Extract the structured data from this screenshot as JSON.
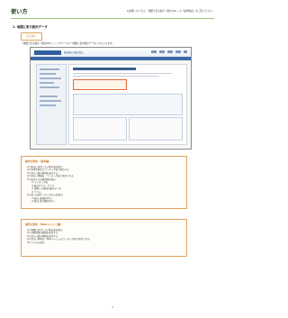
{
  "header": {
    "title": "使い方",
    "note": "※詳細については、「地図で見る統計（統計GIS）」の「操作解説」をご覧ください。"
  },
  "section": {
    "heading": "1. 地図に表す統計データ",
    "tag": "はじめに",
    "intro": "「地図で見る統計（統計GIS）」トップページの「地図に表す統計データ」から入ります。"
  },
  "screenshot": {
    "site_title": "政府統計の総合窓口"
  },
  "callout1": {
    "title": "操作の流れ（基本編）",
    "items": [
      {
        "text": "(1) 統計に表示したい統計表を選ぶ",
        "sub": false
      },
      {
        "text": "(2) 日本全国からランキング表で表示する",
        "sub": false
      },
      {
        "text": "(3) 見たい統計地域を表示する",
        "sub": false
      },
      {
        "text": "(4) 見たい地域を、ランキング表で表示される",
        "sub": false
      },
      {
        "text": "(5) 表示する分析地域を選ぶ",
        "sub": false
      },
      {
        "text": "① ランキング表",
        "sub": true
      },
      {
        "text": "② 統計グラフ・グラフ",
        "sub": true
      },
      {
        "text": "③ 選択した地域の統計データ",
        "sub": true
      },
      {
        "text": "④ ラベル",
        "sub": true
      },
      {
        "text": "(6) 表への表示（データの入れ替え）",
        "sub": false
      },
      {
        "text": "① 統計 表選択ボタン",
        "sub": true
      },
      {
        "text": "② 統計 表示選択ボタン",
        "sub": true
      }
    ]
  },
  "callout2": {
    "title": "操作の流れ（Webメッシュ編）",
    "items": [
      {
        "text": "(1) 地図に表示したい統計表を選ぶ",
        "sub": false
      },
      {
        "text": "(2) 対象地域の範囲を表示する",
        "sub": false
      },
      {
        "text": "(3) 見たい統計地域を表示する",
        "sub": false
      },
      {
        "text": "(4) 見たい地域が、Webメッシュのランキング表で表示される",
        "sub": false
      },
      {
        "text": "(5) ラベルの表示",
        "sub": false
      }
    ]
  },
  "footer": {
    "page_number": "1"
  }
}
